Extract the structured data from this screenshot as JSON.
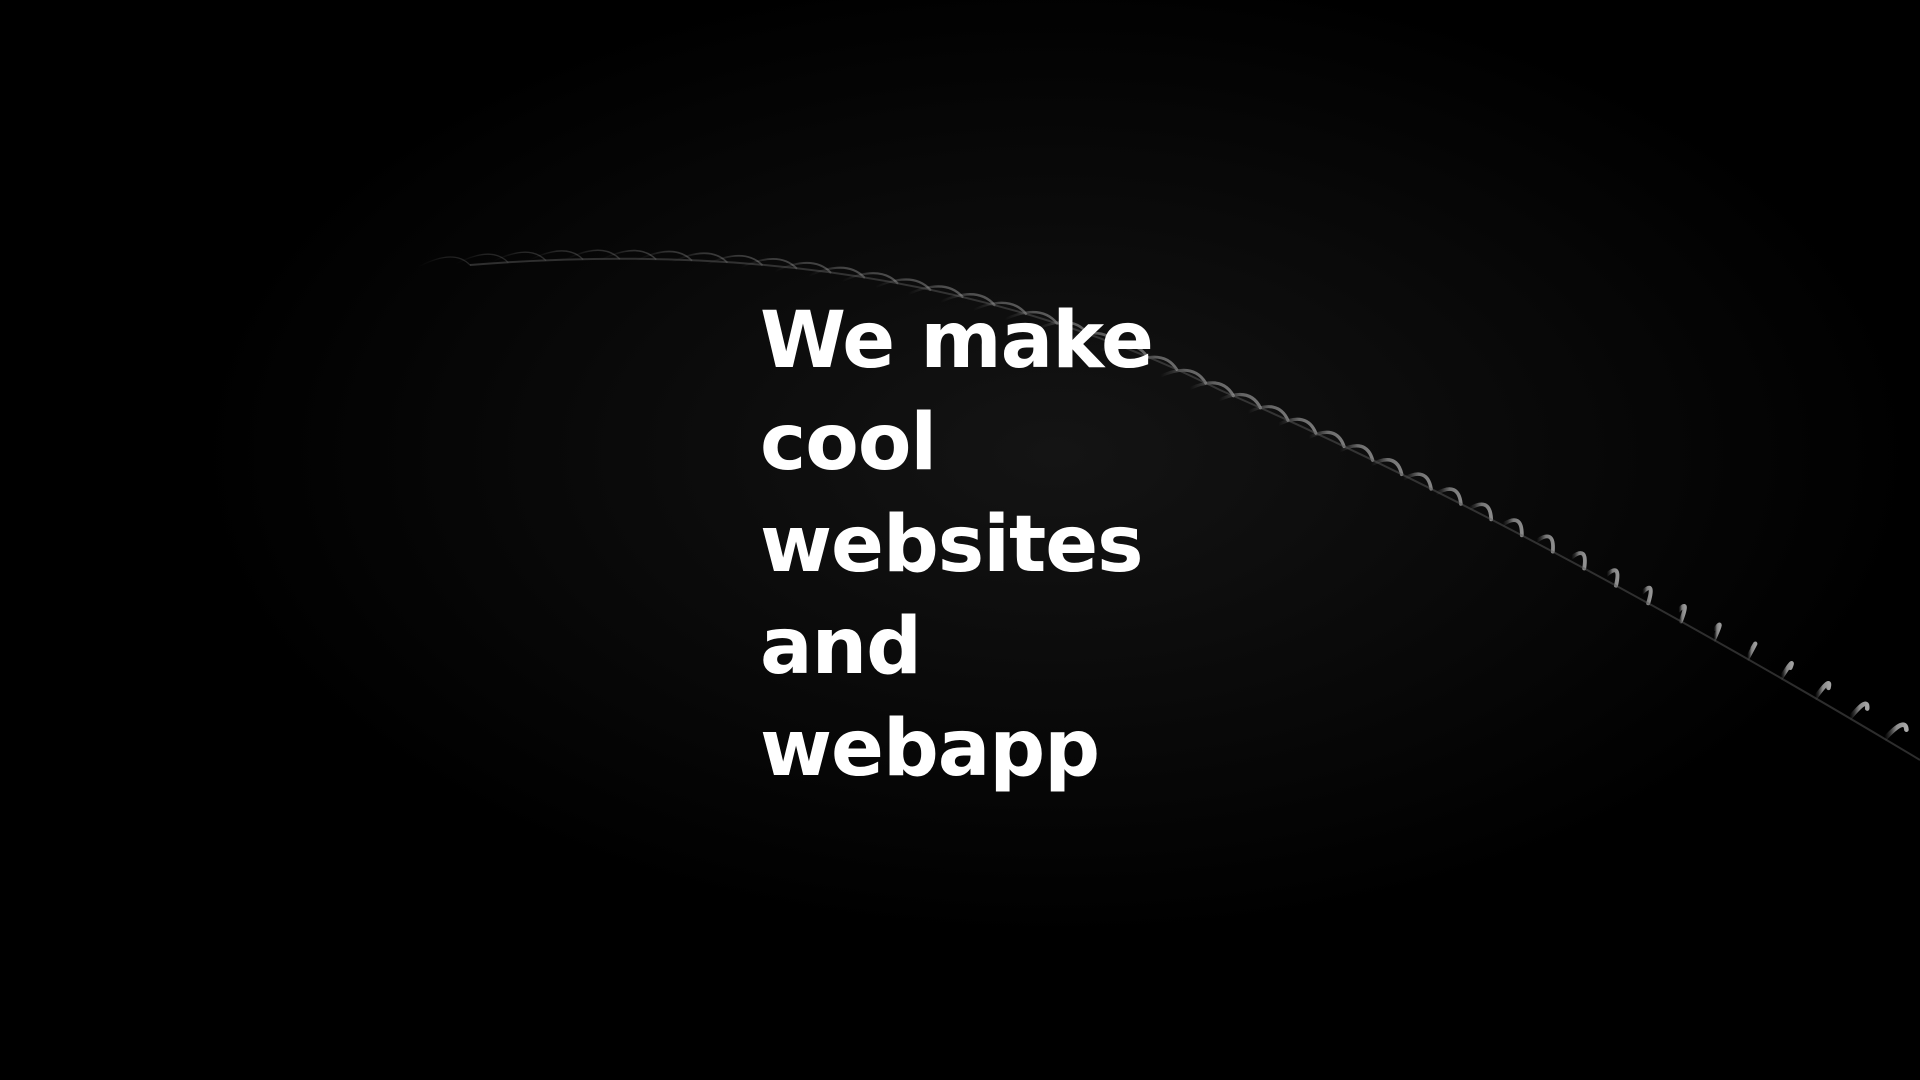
{
  "hero": {
    "headline_lines": [
      "We make",
      "cool",
      "websites",
      "and",
      "webapp"
    ],
    "background_image": "palm-leaf-silhouette",
    "colors": {
      "background": "#000000",
      "text": "#ffffff",
      "leaf_highlight": "#d9d9d9"
    }
  }
}
